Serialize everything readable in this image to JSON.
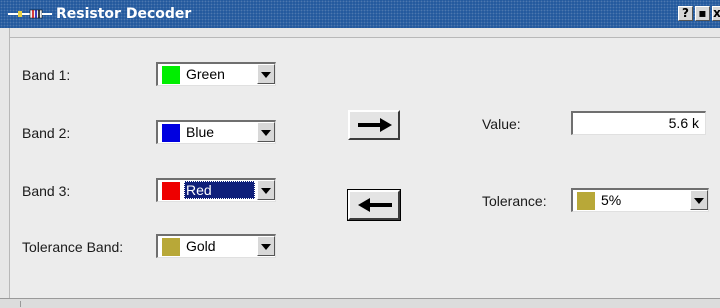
{
  "window": {
    "title": "Resistor Decoder",
    "title_buttons": {
      "help": "?",
      "maximize": "▪",
      "close": "x"
    }
  },
  "bands": [
    {
      "label": "Band 1:",
      "value": "Green",
      "color": "#00ee00",
      "selected": false
    },
    {
      "label": "Band 2:",
      "value": "Blue",
      "color": "#0000e0",
      "selected": false
    },
    {
      "label": "Band 3:",
      "value": "Red",
      "color": "#ee0000",
      "selected": true
    },
    {
      "label": "Tolerance Band:",
      "value": "Gold",
      "color": "#b8a838",
      "selected": false
    }
  ],
  "buttons": {
    "decode_icon": "arrow-right-icon",
    "encode_icon": "arrow-left-icon"
  },
  "value": {
    "label": "Value:",
    "text": "5.6 k"
  },
  "tolerance": {
    "label": "Tolerance:",
    "value": "5%",
    "color": "#b8a838"
  },
  "colors": {
    "titlebar": "#245a9e",
    "window_bg": "#ececec",
    "selection": "#0f1f7a"
  }
}
